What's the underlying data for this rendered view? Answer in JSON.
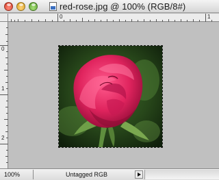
{
  "window": {
    "title": "red-rose.jpg @ 100% (RGB/8#)"
  },
  "rulers": {
    "top_labels": [
      "0",
      "1"
    ],
    "left_labels": [
      "0",
      "1",
      "2"
    ]
  },
  "statusbar": {
    "zoom": "100%",
    "profile": "Untagged RGB"
  },
  "colors": {
    "canvas_bg": "#c0c0c0",
    "rose": "#e0245e",
    "foliage": "#2f5a1f"
  }
}
